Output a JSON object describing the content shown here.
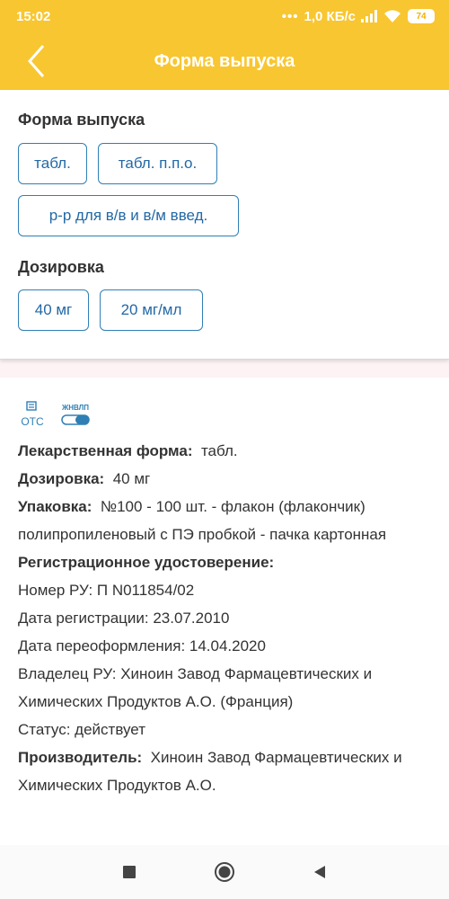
{
  "status_bar": {
    "time": "15:02",
    "network": "1,0 КБ/с",
    "battery": "74"
  },
  "app_bar": {
    "title": "Форма выпуска"
  },
  "form_panel": {
    "form_title": "Форма выпуска",
    "forms": [
      "табл.",
      "табл. п.п.о.",
      "р-р для в/в и в/м введ."
    ],
    "dosage_title": "Дозировка",
    "dosages": [
      "40 мг",
      "20 мг/мл"
    ]
  },
  "badges": {
    "otc": "OTC",
    "zhnvlp": "ЖНВЛП"
  },
  "details": {
    "dosage_form_label": "Лекарственная форма:",
    "dosage_form_value": "табл.",
    "dosage_label": "Дозировка:",
    "dosage_value": "40 мг",
    "package_label": "Упаковка:",
    "package_value": "№100 - 100 шт. - флакон (флакончик) полипропиленовый с ПЭ пробкой - пачка картонная",
    "reg_label": "Регистрационное удостоверение:",
    "ru_number": "Номер РУ: П N011854/02",
    "reg_date": "Дата регистрации: 23.07.2010",
    "rereg_date": "Дата переоформления: 14.04.2020",
    "owner": "Владелец РУ: Хиноин Завод Фармацевтических и Химических Продуктов А.О. (Франция)",
    "status": "Статус: действует",
    "manufacturer_label": "Производитель:",
    "manufacturer_value": "Хиноин Завод Фармацевтических и Химических Продуктов А.О."
  },
  "colors": {
    "accent": "#f8c630",
    "chip_border": "#2f7fb5",
    "chip_text": "#2268a6"
  },
  "icons": {
    "back": "chevron-left-icon",
    "nav_recents": "square-icon",
    "nav_home": "circle-icon",
    "nav_back": "triangle-back-icon"
  }
}
